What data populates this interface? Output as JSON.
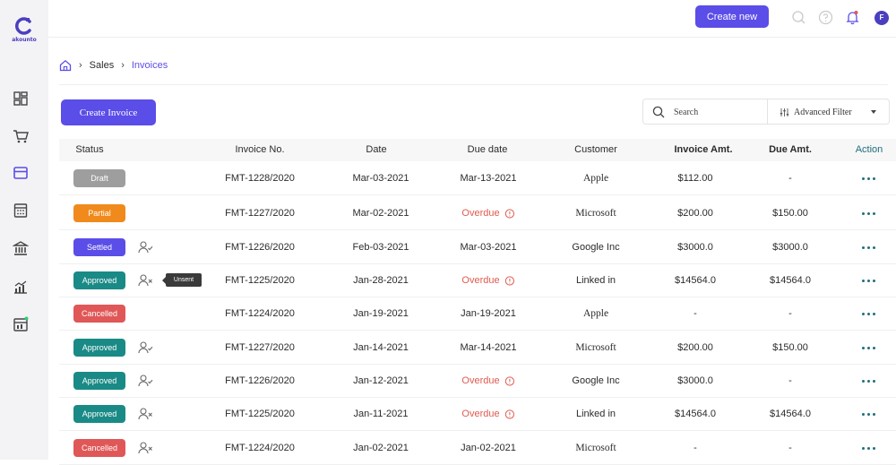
{
  "app": {
    "logo_text": "akounto"
  },
  "topbar": {
    "create_new_label": "Create new",
    "avatar_initial": "F"
  },
  "breadcrumb": {
    "sales": "Sales",
    "invoices": "Invoices"
  },
  "toolbar": {
    "create_invoice_label": "Create Invoice",
    "search_placeholder": "Search",
    "advanced_filter_label": "Advanced Filter"
  },
  "colors": {
    "accent": "#5b4de8",
    "draft": "#9e9e9e",
    "partial": "#f08a1c",
    "settled": "#5b4de8",
    "approved": "#1a8a86",
    "cancelled": "#e05757",
    "overdue": "#e05a4f",
    "action": "#1f6f7a"
  },
  "table": {
    "columns": [
      "Status",
      "Invoice No.",
      "Date",
      "Due date",
      "Customer",
      "Invoice Amt.",
      "Due Amt.",
      "Action"
    ],
    "rows": [
      {
        "status": "Draft",
        "status_color": "#9e9e9e",
        "user_icon": "",
        "tooltip": "",
        "invoice_no": "FMT-1228/2020",
        "date": "Mar-03-2021",
        "due_date": "Mar-13-2021",
        "overdue": false,
        "customer": "Apple",
        "customer_serif": true,
        "invoice_amt": "$112.00",
        "due_amt": "-"
      },
      {
        "status": "Partial",
        "status_color": "#f08a1c",
        "user_icon": "",
        "tooltip": "",
        "invoice_no": "FMT-1227/2020",
        "date": "Mar-02-2021",
        "due_date": "Overdue",
        "overdue": true,
        "customer": "Microsoft",
        "customer_serif": true,
        "invoice_amt": "$200.00",
        "due_amt": "$150.00"
      },
      {
        "status": "Settled",
        "status_color": "#5b4de8",
        "user_icon": "user-check-icon",
        "tooltip": "",
        "invoice_no": "FMT-1226/2020",
        "date": "Feb-03-2021",
        "due_date": "Mar-03-2021",
        "overdue": false,
        "customer": "Google Inc",
        "customer_serif": false,
        "invoice_amt": "$3000.0",
        "due_amt": "$3000.0"
      },
      {
        "status": "Approved",
        "status_color": "#1a8a86",
        "user_icon": "user-x-icon",
        "tooltip": "Unsent",
        "invoice_no": "FMT-1225/2020",
        "date": "Jan-28-2021",
        "due_date": "Overdue",
        "overdue": true,
        "customer": "Linked in",
        "customer_serif": false,
        "invoice_amt": "$14564.0",
        "due_amt": "$14564.0"
      },
      {
        "status": "Cancelled",
        "status_color": "#e05757",
        "user_icon": "",
        "tooltip": "",
        "invoice_no": "FMT-1224/2020",
        "date": "Jan-19-2021",
        "due_date": "Jan-19-2021",
        "overdue": false,
        "customer": "Apple",
        "customer_serif": true,
        "invoice_amt": "-",
        "due_amt": "-"
      },
      {
        "status": "Approved",
        "status_color": "#1a8a86",
        "user_icon": "user-check-icon",
        "tooltip": "",
        "invoice_no": "FMT-1227/2020",
        "date": "Jan-14-2021",
        "due_date": "Mar-14-2021",
        "overdue": false,
        "customer": "Microsoft",
        "customer_serif": true,
        "invoice_amt": "$200.00",
        "due_amt": "$150.00"
      },
      {
        "status": "Approved",
        "status_color": "#1a8a86",
        "user_icon": "user-check-icon",
        "tooltip": "",
        "invoice_no": "FMT-1226/2020",
        "date": "Jan-12-2021",
        "due_date": "Overdue",
        "overdue": true,
        "customer": "Google Inc",
        "customer_serif": false,
        "invoice_amt": "$3000.0",
        "due_amt": "-"
      },
      {
        "status": "Approved",
        "status_color": "#1a8a86",
        "user_icon": "user-x-icon",
        "tooltip": "",
        "invoice_no": "FMT-1225/2020",
        "date": "Jan-11-2021",
        "due_date": "Overdue",
        "overdue": true,
        "customer": "Linked in",
        "customer_serif": false,
        "invoice_amt": "$14564.0",
        "due_amt": "$14564.0"
      },
      {
        "status": "Cancelled",
        "status_color": "#e05757",
        "user_icon": "user-x-icon",
        "tooltip": "",
        "invoice_no": "FMT-1224/2020",
        "date": "Jan-02-2021",
        "due_date": "Jan-02-2021",
        "overdue": false,
        "customer": "Microsoft",
        "customer_serif": true,
        "invoice_amt": "-",
        "due_amt": "-"
      }
    ]
  }
}
